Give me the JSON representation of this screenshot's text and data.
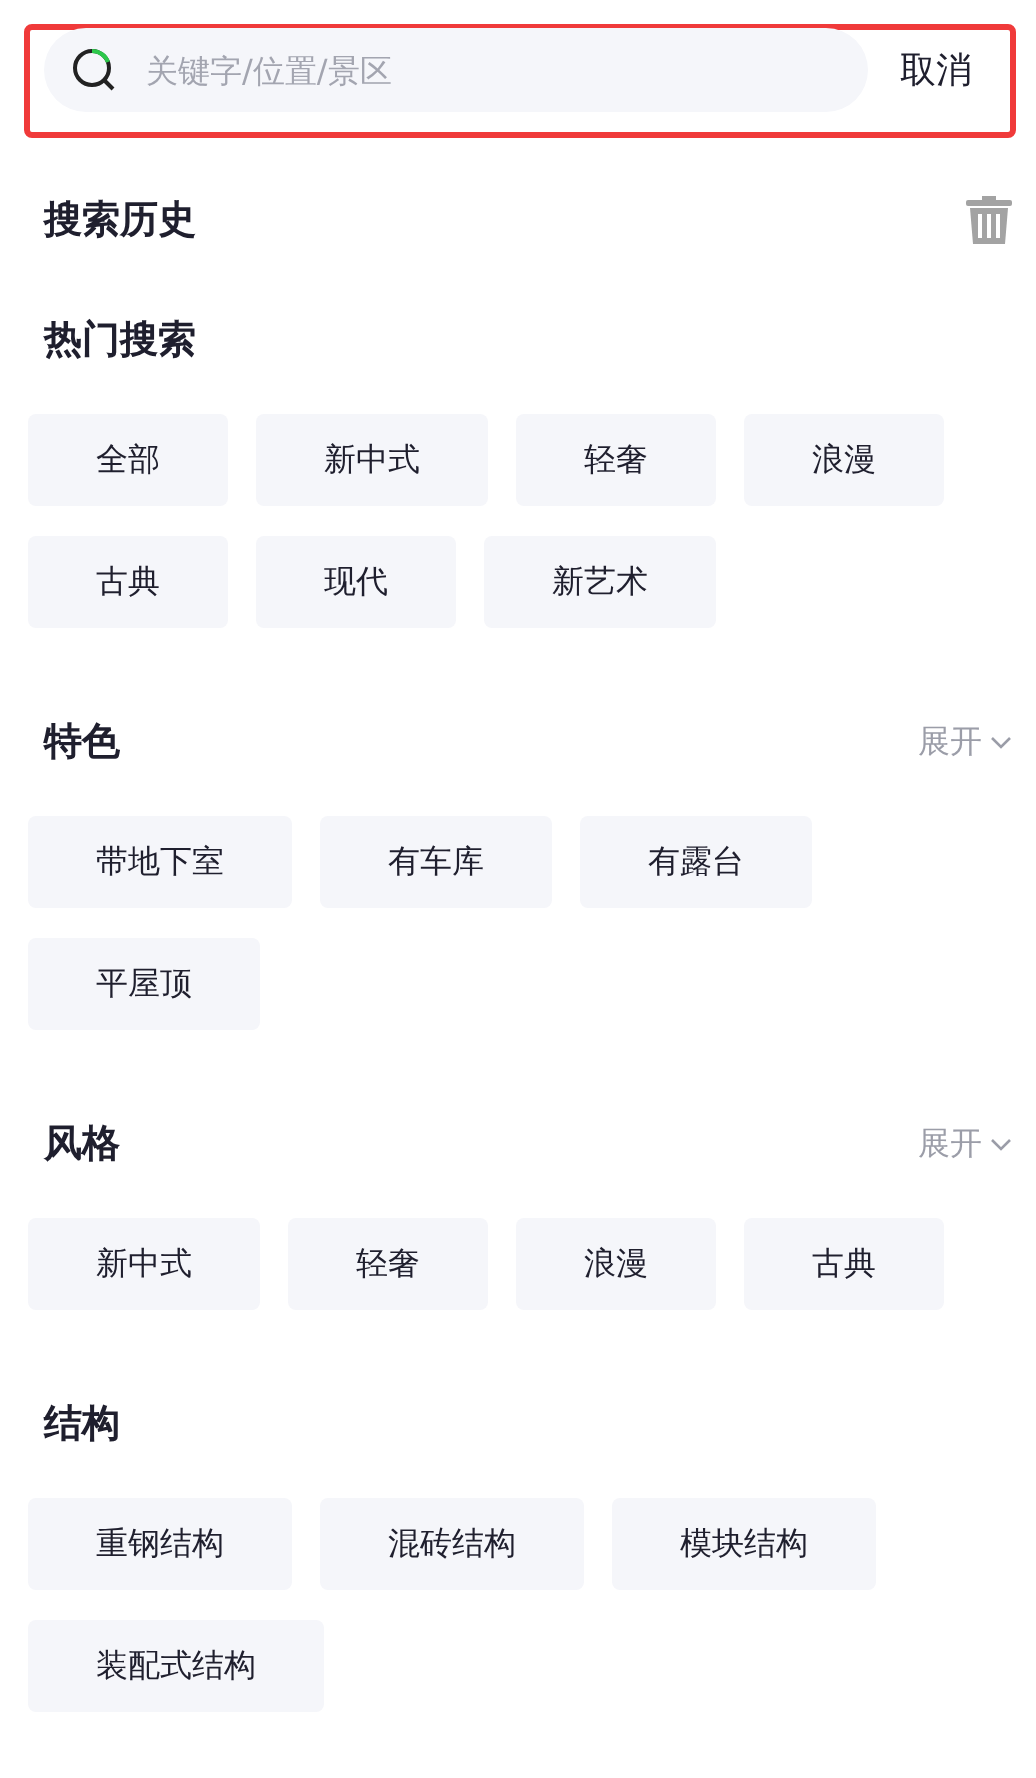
{
  "search": {
    "placeholder": "关键字/位置/景区",
    "cancel": "取消",
    "highlighted": true
  },
  "sections": [
    {
      "title": "搜索历史",
      "action": {
        "kind": "clear"
      }
    },
    {
      "title": "热门搜索",
      "tags": [
        "全部",
        "新中式",
        "轻奢",
        "浪漫",
        "古典",
        "现代",
        "新艺术"
      ]
    },
    {
      "title": "特色",
      "action": {
        "kind": "expand",
        "label": "展开"
      },
      "tags": [
        "带地下室",
        "有车库",
        "有露台",
        "平屋顶"
      ]
    },
    {
      "title": "风格",
      "action": {
        "kind": "expand",
        "label": "展开"
      },
      "tags": [
        "新中式",
        "轻奢",
        "浪漫",
        "古典"
      ]
    },
    {
      "title": "结构",
      "tags": [
        "重钢结构",
        "混砖结构",
        "模块结构",
        "装配式结构"
      ]
    }
  ]
}
